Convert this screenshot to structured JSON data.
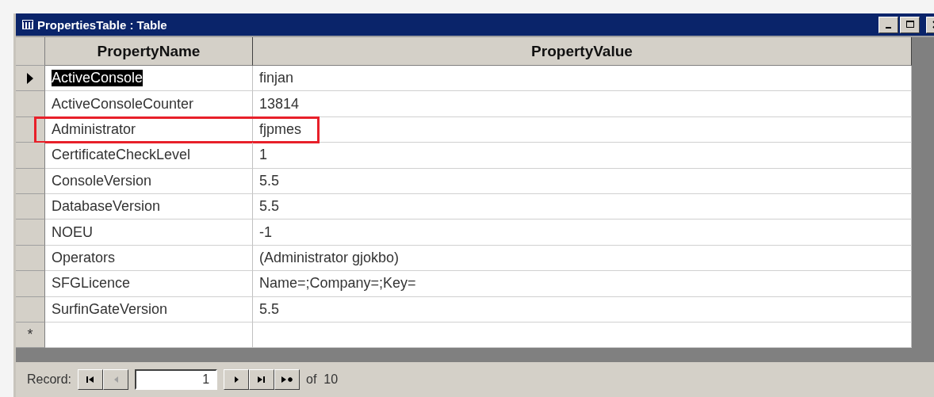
{
  "window": {
    "title": "PropertiesTable : Table"
  },
  "table": {
    "columns": [
      "PropertyName",
      "PropertyValue"
    ],
    "rows": [
      {
        "kind": "record",
        "name": "ActiveConsole",
        "value": "finjan",
        "current": true,
        "highlighted": false
      },
      {
        "kind": "record",
        "name": "ActiveConsoleCounter",
        "value": "13814",
        "current": false,
        "highlighted": false
      },
      {
        "kind": "record",
        "name": "Administrator",
        "value": "fjpmes",
        "current": false,
        "highlighted": true
      },
      {
        "kind": "record",
        "name": "CertificateCheckLevel",
        "value": "1",
        "current": false,
        "highlighted": false
      },
      {
        "kind": "record",
        "name": "ConsoleVersion",
        "value": "5.5",
        "current": false,
        "highlighted": false
      },
      {
        "kind": "record",
        "name": "DatabaseVersion",
        "value": "5.5",
        "current": false,
        "highlighted": false
      },
      {
        "kind": "record",
        "name": "NOEU",
        "value": "-1",
        "current": false,
        "highlighted": false
      },
      {
        "kind": "record",
        "name": "Operators",
        "value": "(Administrator gjokbo)",
        "current": false,
        "highlighted": false
      },
      {
        "kind": "record",
        "name": "SFGLicence",
        "value": "Name=;Company=;Key=",
        "current": false,
        "highlighted": false
      },
      {
        "kind": "record",
        "name": "SurfinGateVersion",
        "value": "5.5",
        "current": false,
        "highlighted": false
      },
      {
        "kind": "new",
        "marker": "*"
      }
    ]
  },
  "navigator": {
    "label": "Record:",
    "buttons": [
      {
        "kind": "first",
        "disabled": false
      },
      {
        "kind": "prev",
        "disabled": true
      }
    ],
    "current": "1",
    "buttons_after": [
      {
        "kind": "next",
        "disabled": false
      },
      {
        "kind": "last",
        "disabled": false
      },
      {
        "kind": "new",
        "disabled": false
      }
    ],
    "total": "of  10"
  }
}
